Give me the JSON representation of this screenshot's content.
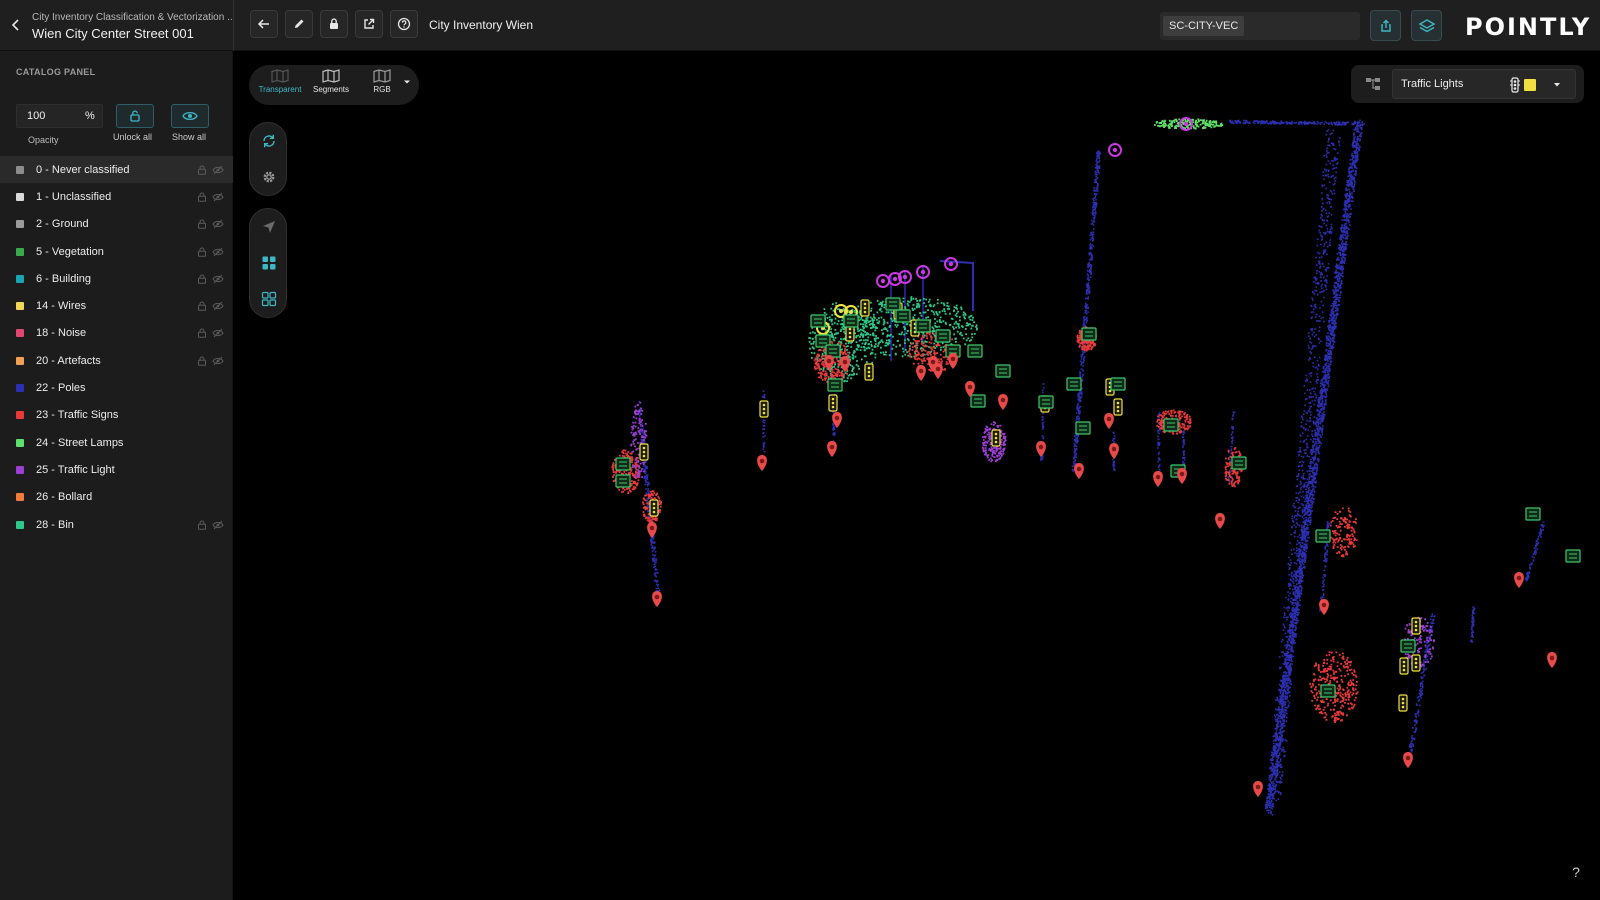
{
  "header": {
    "project_subtitle": "City Inventory Classification & Vectorization ...",
    "project_title": "Wien City Center Street 001",
    "dataset_name": "City Inventory Wien",
    "code": "SC-CITY-VEC",
    "brand": "POINTLY"
  },
  "panel": {
    "title": "CATALOG PANEL",
    "opacity_value": "100",
    "opacity_unit": "%",
    "opacity_label": "Opacity",
    "unlock_label": "Unlock all",
    "show_label": "Show all",
    "classes": [
      {
        "label": "0 - Never classified",
        "color": "#8c8c8c"
      },
      {
        "label": "1 - Unclassified",
        "color": "#d9d9d9"
      },
      {
        "label": "2 - Ground",
        "color": "#9b9b9b"
      },
      {
        "label": "5 - Vegetation",
        "color": "#3aa94b"
      },
      {
        "label": "6 - Building",
        "color": "#1aa3b0"
      },
      {
        "label": "14 - Wires",
        "color": "#f2d65a"
      },
      {
        "label": "18 - Noise",
        "color": "#e2456e"
      },
      {
        "label": "20 - Artefacts",
        "color": "#f0a054"
      },
      {
        "label": "22 - Poles",
        "color": "#2b2fb0"
      },
      {
        "label": "23 - Traffic Signs",
        "color": "#e83a3a"
      },
      {
        "label": "24 - Street Lamps",
        "color": "#5fe06a"
      },
      {
        "label": "25 - Traffic Light",
        "color": "#9b3fd4"
      },
      {
        "label": "26 - Bollard",
        "color": "#f27a3a"
      },
      {
        "label": "28 - Bin",
        "color": "#2ec98a"
      }
    ]
  },
  "viewer": {
    "modes": [
      {
        "label": "Transparent",
        "color": "#3fb8c6"
      },
      {
        "label": "Segments",
        "color": "#e6e6e6"
      },
      {
        "label": "RGB",
        "color": "#e6e6e6"
      }
    ],
    "layer_name": "Traffic Lights",
    "layer_color": "#f0e040",
    "help": "?"
  },
  "colors": {
    "accent": "#3fb8c6",
    "poles": "#2b2fb0",
    "signs": "#e83a3a",
    "signs_marker": "#e84a4a",
    "lamps": "#5fe06a",
    "lights": "#9b3fd4",
    "lights_magenta": "#c83ae0",
    "bin": "#2ec98a",
    "traffic_light_icon": "#f0e040",
    "sign_icon": "#3fc66a"
  }
}
